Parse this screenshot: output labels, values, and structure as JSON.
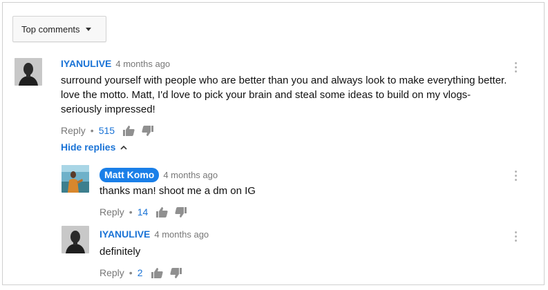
{
  "sort": {
    "label": "Top comments"
  },
  "comments": [
    {
      "author": "IYANULIVE",
      "time": "4 months ago",
      "text": "surround yourself with people who are better than you and always look to make everything better. love the motto. Matt, I'd love to pick your brain and steal some ideas to build on my vlogs- seriously impressed!",
      "reply_label": "Reply",
      "separator": "•",
      "likes": "515",
      "hide_replies_label": "Hide replies",
      "replies": [
        {
          "author": "Matt Komo",
          "time": "4 months ago",
          "text": "thanks man!  shoot me a dm on IG",
          "reply_label": "Reply",
          "separator": "•",
          "likes": "14"
        },
        {
          "author": "IYANULIVE",
          "time": "4 months ago",
          "text": "definitely",
          "reply_label": "Reply",
          "separator": "•",
          "likes": "2"
        }
      ]
    }
  ],
  "colors": {
    "link_blue": "#1a73d6",
    "owner_badge": "#1a7fe8",
    "muted": "#777777"
  },
  "icons": [
    "caret-down-icon",
    "thumbs-up-icon",
    "thumbs-down-icon",
    "chevron-up-icon",
    "more-vert-icon"
  ]
}
